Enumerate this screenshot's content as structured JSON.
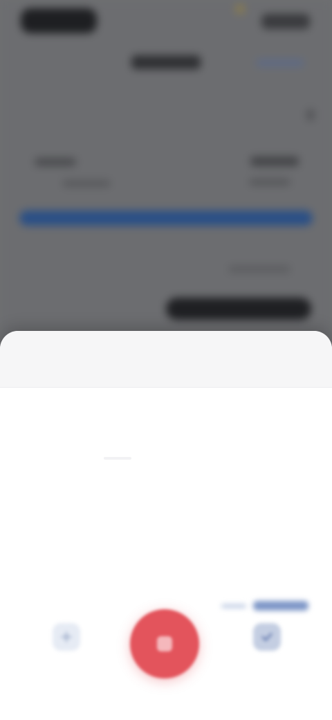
{
  "background_screen": {
    "status_time": "",
    "nav_title": "",
    "nav_action": "",
    "left_label": "",
    "left_sublabel": "",
    "right_label": "",
    "right_sublabel": "",
    "progress_fraction": 1.0,
    "meta_text": "",
    "primary_button_label": ""
  },
  "sheet": {
    "title": "",
    "link_label": ""
  },
  "actions": {
    "left_label": "",
    "left_icon": "plus-icon",
    "record_icon": "stop-icon",
    "right_label": "",
    "right_icon": "checkmark-icon"
  },
  "colors": {
    "scrim": "#6c6d70",
    "progress_fill": "#2a4f86",
    "record_button": "#e3545c",
    "link": "#3d68b3",
    "sheet_bg": "#ffffff"
  }
}
